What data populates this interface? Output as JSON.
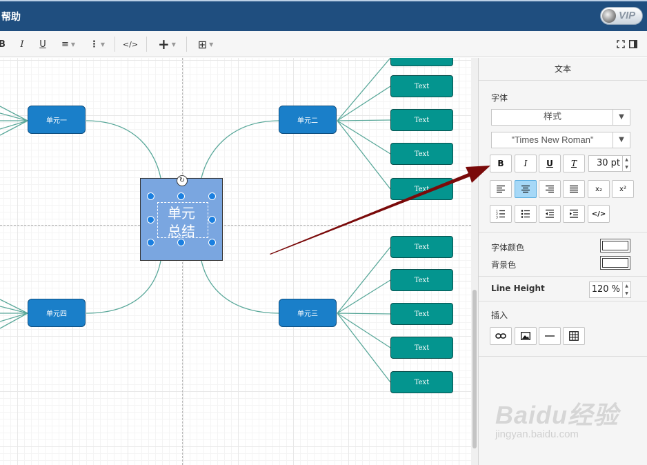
{
  "titlebar": {
    "menu_help": "帮助",
    "vip_label": "VIP"
  },
  "toolbar": {
    "bold": "B",
    "italic": "I",
    "underline": "U",
    "align": "≡",
    "more": "⋮",
    "code": "</>",
    "insert": "+",
    "table": "⊞"
  },
  "canvas": {
    "central": {
      "line1": "单元",
      "line2": "总结"
    },
    "units": {
      "u1": "单元一",
      "u2": "单元二",
      "u3": "单元三",
      "u4": "单元四"
    },
    "text_label": "Text"
  },
  "panel": {
    "title": "文本",
    "font_section": "字体",
    "style_select": "样式",
    "font_select": "\"Times New Roman\"",
    "font_size": "30 pt",
    "font_color_label": "字体颜色",
    "bg_color_label": "背景色",
    "line_height_label": "Line Height",
    "line_height_value": "120 %",
    "insert_section": "插入",
    "buttons": {
      "bold": "B",
      "italic": "I",
      "underline": "U",
      "clear_format": "T",
      "subscript": "x₂",
      "superscript": "x²",
      "html": "</>"
    }
  },
  "colors": {
    "unit_fill": "#1a7fc9",
    "text_fill": "#04958f",
    "central_fill": "#7aa6e0",
    "connector": "#5aa89a",
    "arrow": "#7a0a0a",
    "title_bar": "#1f4e7f"
  },
  "watermark": {
    "brand": "Baidu经验",
    "url": "jingyan.baidu.com"
  }
}
